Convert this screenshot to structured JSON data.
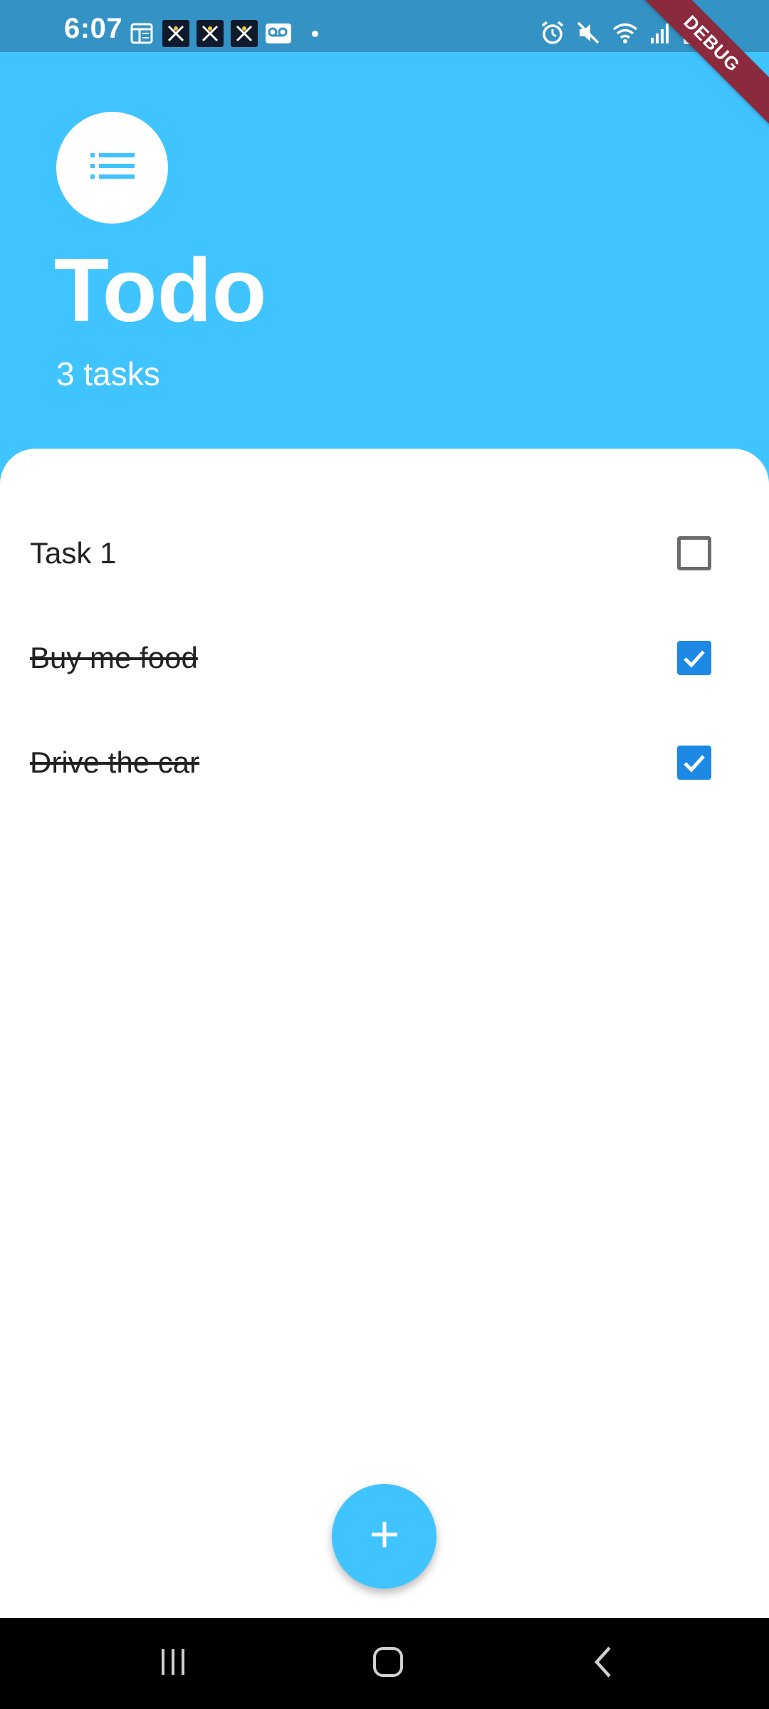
{
  "status_bar": {
    "time": "6:07",
    "debug_label": "DEBUG",
    "background": "#3592c4"
  },
  "header": {
    "title": "Todo",
    "task_count": "3 tasks",
    "background": "#40c4ff",
    "icon": "list-icon"
  },
  "tasks": [
    {
      "label": "Task 1",
      "done": false
    },
    {
      "label": "Buy me food",
      "done": true
    },
    {
      "label": "Drive the car",
      "done": true
    }
  ],
  "fab": {
    "icon": "plus-icon"
  },
  "colors": {
    "accent": "#40c4ff",
    "checkbox_checked": "#1e88e5",
    "checkbox_unchecked": "#6b6b6b"
  },
  "nav_bar": {
    "recents_icon": "recents-icon",
    "home_icon": "home-icon",
    "back_icon": "back-icon"
  }
}
